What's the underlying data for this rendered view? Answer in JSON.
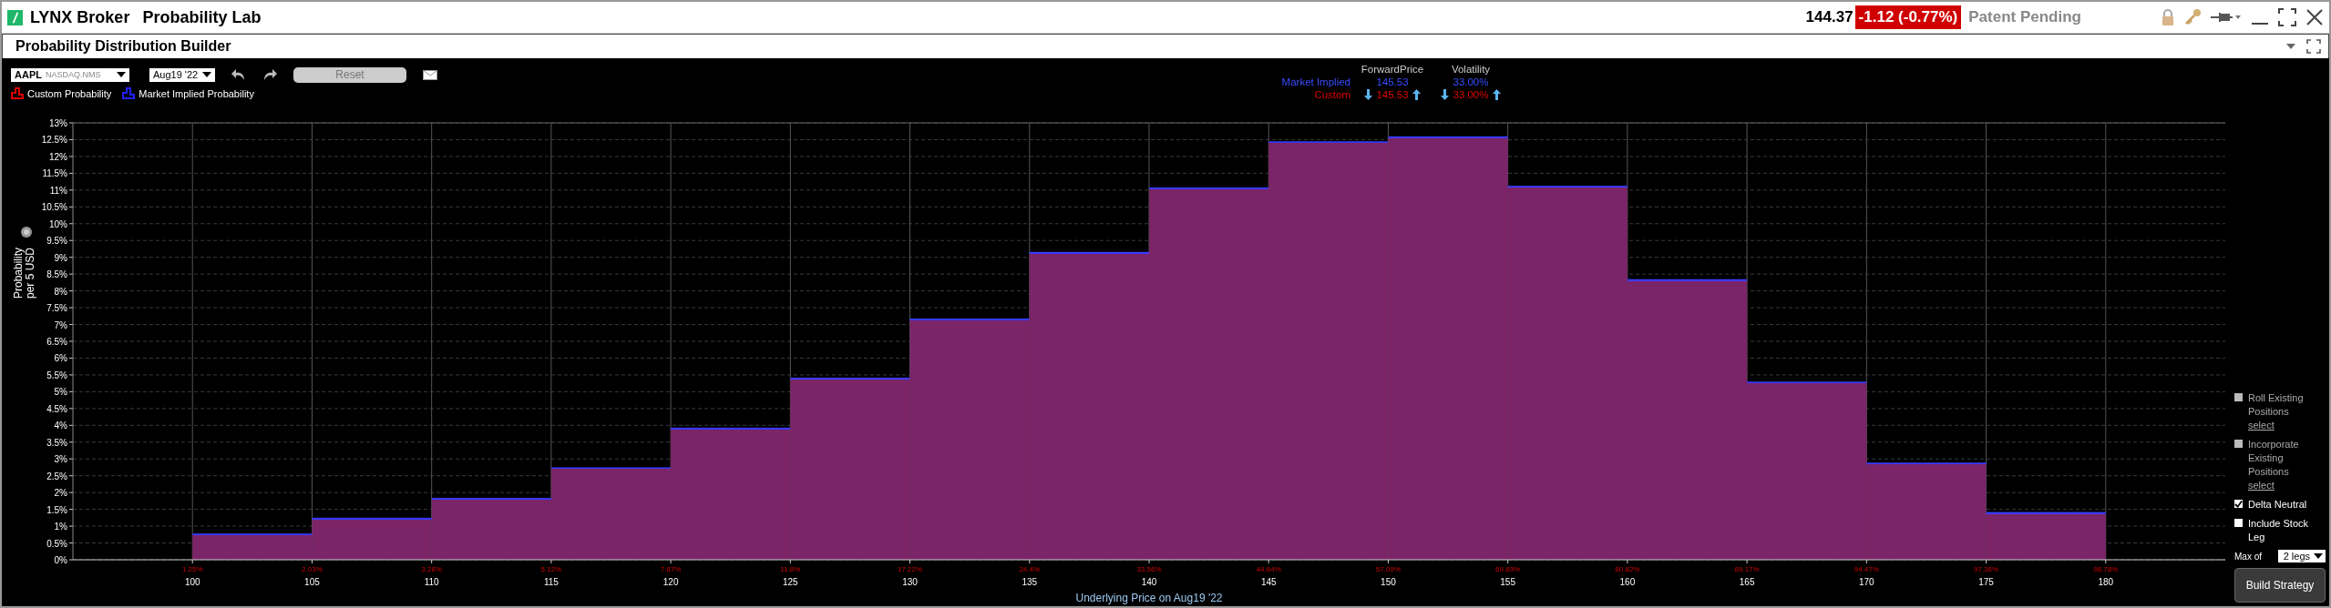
{
  "window": {
    "app": "LYNX Broker",
    "title": "Probability Lab"
  },
  "quote": {
    "last": "144.37",
    "change": "-1.12 (-0.77%)",
    "note": "Patent Pending"
  },
  "panel": {
    "title": "Probability Distribution Builder"
  },
  "toolbar": {
    "symbol": "AAPL",
    "exchange": "NASDAQ.NMS",
    "expiry": "Aug19 '22",
    "reset": {
      "label": "Reset",
      "disabled": true
    }
  },
  "legend": [
    {
      "label": "Custom Probability",
      "color": "#e00000"
    },
    {
      "label": "Market Implied Probability",
      "color": "#2020ff"
    }
  ],
  "forward": {
    "columns": [
      "ForwardPrice",
      "Volatility"
    ],
    "rows": [
      {
        "label": "Market Implied",
        "kind": "plain",
        "color": "#3a4cff",
        "values": [
          "145.53",
          "33.00%"
        ]
      },
      {
        "label": "Custom",
        "kind": "adjustable",
        "color": "#e00000",
        "values": [
          "145.53",
          "33.00%"
        ]
      }
    ]
  },
  "chart": {
    "cumulative_labels": [
      "1.25%",
      "2.03%",
      "3.28%",
      "5.12%",
      "7.87%",
      "11.8%",
      "17.22%",
      "24.4%",
      "33.56%",
      "44.64%",
      "57.09%",
      "69.69%",
      "80.82%",
      "89.17%",
      "94.47%",
      "97.36%",
      "98.78%"
    ],
    "chart_data": {
      "type": "bar",
      "xlabel": "Underlying Price on Aug19 '22",
      "ylabel": "Probability per 5 USD",
      "x": [
        102.5,
        107.5,
        112.5,
        117.5,
        122.5,
        127.5,
        132.5,
        137.5,
        142.5,
        147.5,
        152.5,
        157.5,
        162.5,
        167.5,
        172.5,
        177.5
      ],
      "values": [
        0.78,
        1.25,
        1.84,
        2.75,
        3.93,
        5.42,
        7.18,
        9.16,
        11.08,
        12.45,
        12.6,
        11.13,
        8.35,
        5.3,
        2.89,
        1.42
      ],
      "grid": true,
      "xlim": [
        95,
        185
      ],
      "ylim": [
        0,
        13
      ],
      "xticks": [
        100,
        105,
        110,
        115,
        120,
        125,
        130,
        135,
        140,
        145,
        150,
        155,
        160,
        165,
        170,
        175,
        180
      ],
      "yticks": [
        {
          "value": 0,
          "label": "0%"
        },
        {
          "value": 0.5,
          "label": "0.5%"
        },
        {
          "value": 1,
          "label": "1%"
        },
        {
          "value": 1.5,
          "label": "1.5%"
        },
        {
          "value": 2,
          "label": "2%"
        },
        {
          "value": 2.5,
          "label": "2.5%"
        },
        {
          "value": 3,
          "label": "3%"
        },
        {
          "value": 3.5,
          "label": "3.5%"
        },
        {
          "value": 4,
          "label": "4%"
        },
        {
          "value": 4.5,
          "label": "4.5%"
        },
        {
          "value": 5,
          "label": "5%"
        },
        {
          "value": 5.5,
          "label": "5.5%"
        },
        {
          "value": 6,
          "label": "6%"
        },
        {
          "value": 6.5,
          "label": "6.5%"
        },
        {
          "value": 7,
          "label": "7%"
        },
        {
          "value": 7.5,
          "label": "7.5%"
        },
        {
          "value": 8,
          "label": "8%"
        },
        {
          "value": 8.5,
          "label": "8.5%"
        },
        {
          "value": 9,
          "label": "9%"
        },
        {
          "value": 9.5,
          "label": "9.5%"
        },
        {
          "value": 10,
          "label": "10%"
        },
        {
          "value": 10.5,
          "label": "10.5%"
        },
        {
          "value": 11,
          "label": "11%"
        },
        {
          "value": 11.5,
          "label": "11.5%"
        },
        {
          "value": 12,
          "label": "12%"
        },
        {
          "value": 12.5,
          "label": "12.5%"
        },
        {
          "value": 13,
          "label": "13%"
        }
      ]
    }
  },
  "options": [
    {
      "label": "Roll Existing Positions",
      "checked": false,
      "disabled": true,
      "link": "select"
    },
    {
      "label": "Incorporate Existing Positions",
      "checked": false,
      "disabled": true,
      "link": "select"
    },
    {
      "label": "Delta Neutral",
      "checked": true,
      "disabled": false
    },
    {
      "label": "Include Stock Leg",
      "checked": false,
      "disabled": false
    }
  ],
  "max_legs": {
    "label": "Max of",
    "value": "2 legs"
  },
  "build_button": "Build Strategy"
}
